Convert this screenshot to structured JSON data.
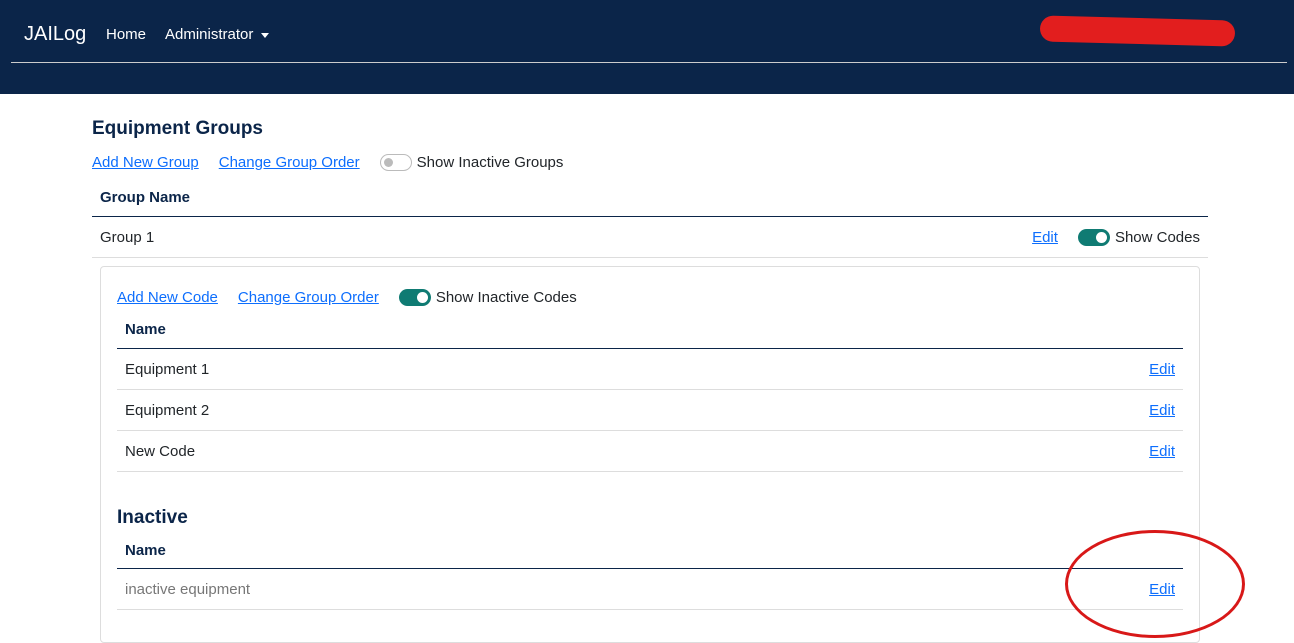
{
  "nav": {
    "brand": "JAILog",
    "home": "Home",
    "admin": "Administrator"
  },
  "groups": {
    "title": "Equipment Groups",
    "add": "Add New Group",
    "order": "Change Group Order",
    "show_inactive": "Show Inactive Groups",
    "show_inactive_on": false,
    "header": "Group Name",
    "rows": [
      {
        "name": "Group 1",
        "edit": "Edit",
        "show_codes": "Show Codes",
        "show_codes_on": true
      }
    ]
  },
  "codes": {
    "add": "Add New Code",
    "order": "Change Group Order",
    "show_inactive": "Show Inactive Codes",
    "show_inactive_on": true,
    "header": "Name",
    "rows": [
      {
        "name": "Equipment 1",
        "edit": "Edit"
      },
      {
        "name": "Equipment 2",
        "edit": "Edit"
      },
      {
        "name": "New Code",
        "edit": "Edit"
      }
    ],
    "inactive_title": "Inactive",
    "inactive_header": "Name",
    "inactive_rows": [
      {
        "name": "inactive equipment",
        "edit": "Edit"
      }
    ]
  },
  "colors": {
    "navbar": "#0b2549",
    "toggle": "#0f7b73",
    "link": "#0d6efd",
    "annotation": "#d81818"
  }
}
